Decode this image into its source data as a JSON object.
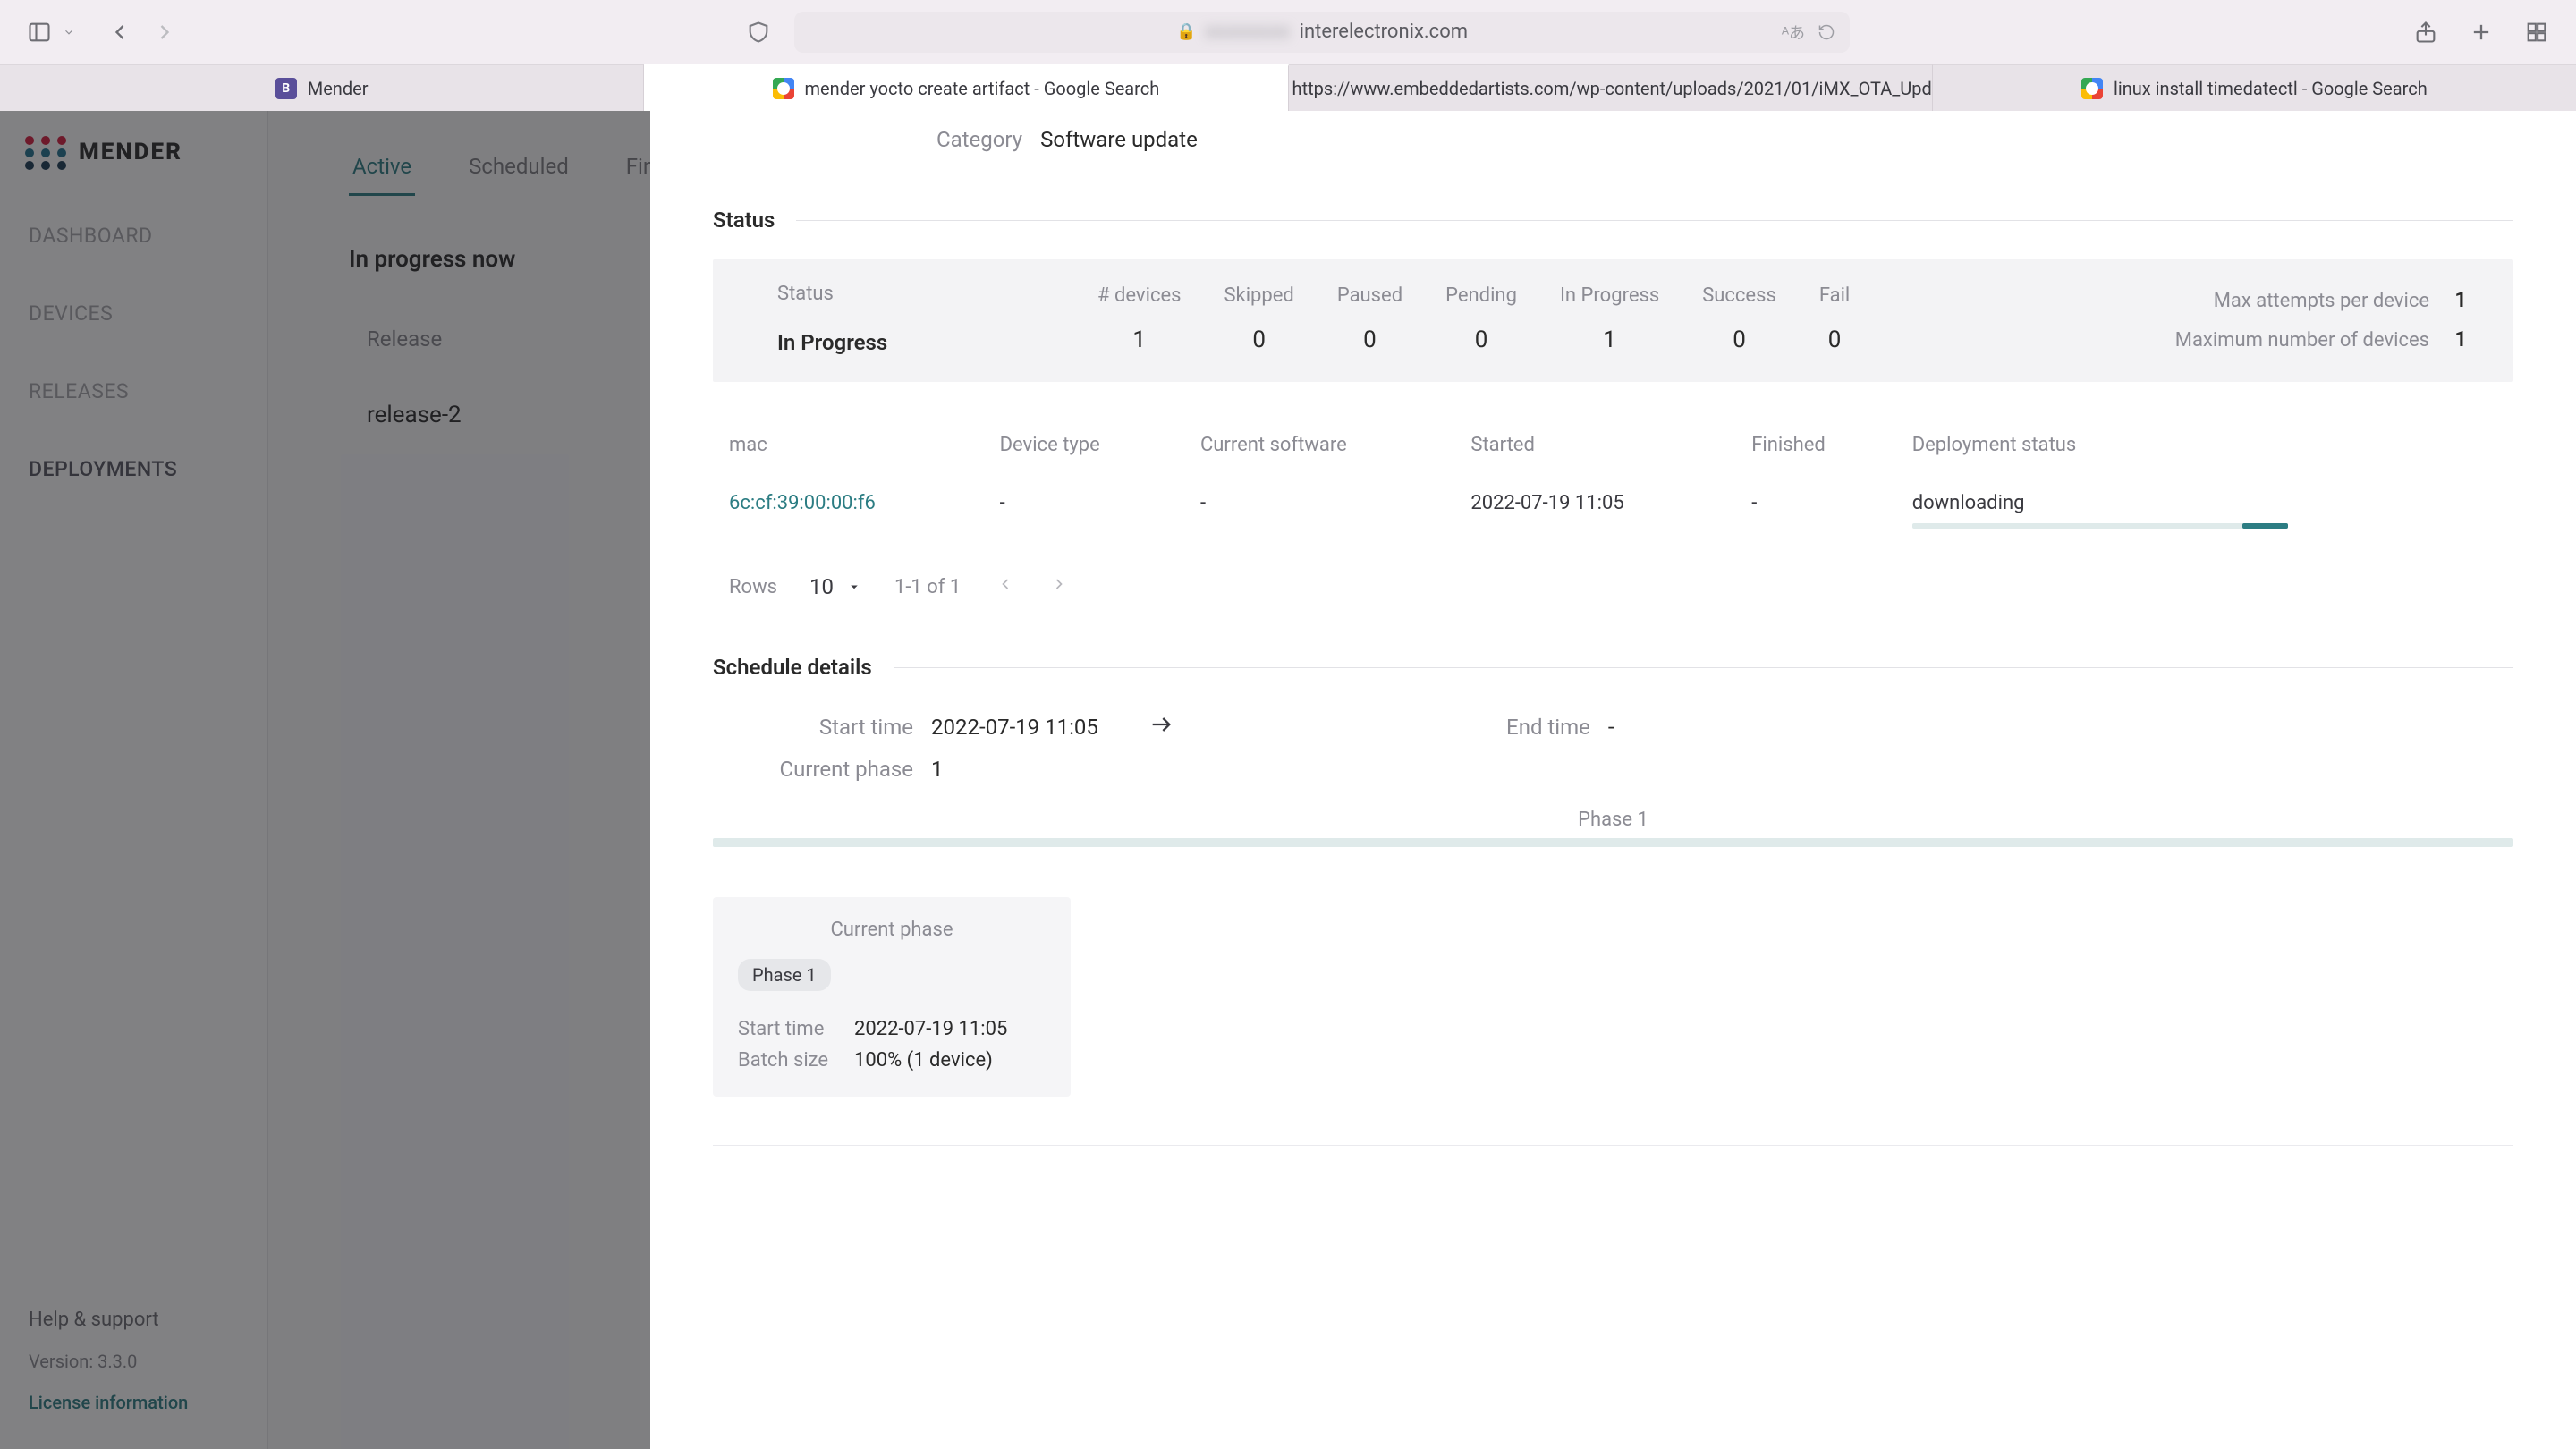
{
  "browser": {
    "address": {
      "blur_prefix": "xxxxxxxx",
      "domain": "interelectronix.com"
    },
    "tabs": [
      {
        "favicon": "B",
        "label": "Mender",
        "active": false
      },
      {
        "favicon": "G",
        "label": "mender yocto create artifact - Google Search",
        "active": true
      },
      {
        "favicon": "E",
        "label": "https://www.embeddedartists.com/wp-content/uploads/2021/01/iMX_OTA_Upd...",
        "active": false
      },
      {
        "favicon": "G",
        "label": "linux install timedatectl - Google Search",
        "active": false
      }
    ]
  },
  "mender": {
    "brand": "MENDER",
    "nav": [
      {
        "label": "DASHBOARD"
      },
      {
        "label": "DEVICES"
      },
      {
        "label": "RELEASES"
      },
      {
        "label": "DEPLOYMENTS",
        "active": true
      }
    ],
    "deploy_tabs": [
      {
        "label": "Active",
        "active": true
      },
      {
        "label": "Scheduled"
      },
      {
        "label": "Finish"
      }
    ],
    "in_progress_header": "In progress now",
    "release_label": "Release",
    "release_value": "release-2",
    "footer": {
      "help": "Help & support",
      "version": "Version: 3.3.0",
      "license": "License information"
    }
  },
  "panel": {
    "category": {
      "label": "Category",
      "value": "Software update"
    },
    "status_section": "Status",
    "status_state": {
      "label": "Status",
      "value": "In Progress"
    },
    "counts_headers": [
      "# devices",
      "Skipped",
      "Paused",
      "Pending",
      "In Progress",
      "Success",
      "Fail"
    ],
    "counts_values": [
      "1",
      "0",
      "0",
      "0",
      "1",
      "0",
      "0"
    ],
    "right_stats": [
      {
        "label": "Max attempts per device",
        "value": "1"
      },
      {
        "label": "Maximum number of devices",
        "value": "1"
      }
    ],
    "table": {
      "headers": [
        "mac",
        "Device type",
        "Current software",
        "Started",
        "Finished",
        "Deployment status"
      ],
      "row": {
        "mac": "6c:cf:39:00:00:f6",
        "device_type": "-",
        "current_software": "-",
        "started": "2022-07-19 11:05",
        "finished": "-",
        "status": "downloading"
      }
    },
    "pagination": {
      "rows_label": "Rows",
      "rows_value": "10",
      "range": "1-1 of 1"
    },
    "schedule_section": "Schedule details",
    "schedule": {
      "start_label": "Start time",
      "start_value": "2022-07-19 11:05",
      "end_label": "End time",
      "end_value": "-",
      "current_phase_label": "Current phase",
      "current_phase_value": "1"
    },
    "phase_bar_label": "Phase 1",
    "phase_card": {
      "title": "Current phase",
      "chip": "Phase 1",
      "start_label": "Start time",
      "start_value": "2022-07-19 11:05",
      "batch_label": "Batch size",
      "batch_value": "100% (1 device)"
    }
  }
}
